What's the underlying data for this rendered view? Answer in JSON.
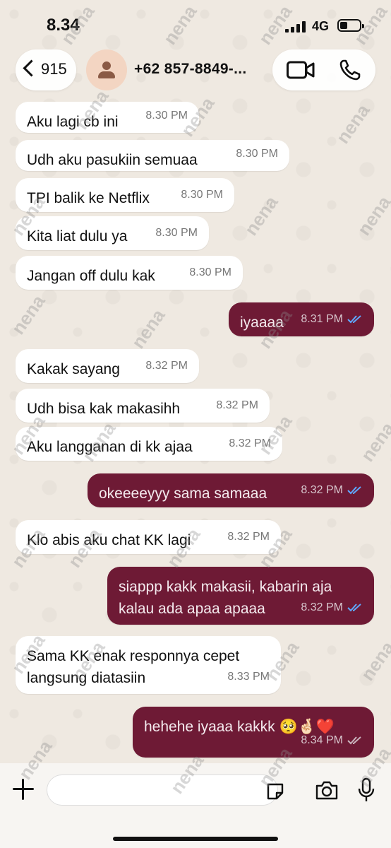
{
  "status_bar": {
    "time": "8.34",
    "network": "4G"
  },
  "header": {
    "back_count": "915",
    "contact_name": "+62 857-8849-...",
    "video_icon": "video-call-icon",
    "phone_icon": "phone-call-icon"
  },
  "messages": [
    {
      "dir": "in",
      "text": "Aku lagi cb ini",
      "time": "8.30 PM"
    },
    {
      "dir": "in",
      "text": "Udh aku pasukiin semuaa",
      "time": "8.30 PM"
    },
    {
      "dir": "in",
      "text": "TPI balik ke Netflix",
      "time": "8.30 PM"
    },
    {
      "dir": "in",
      "text": "Kita liat dulu ya",
      "time": "8.30 PM"
    },
    {
      "dir": "in",
      "text": "Jangan off dulu kak",
      "time": "8.30 PM"
    },
    {
      "dir": "out",
      "text": "iyaaaa",
      "time": "8.31 PM",
      "read": true
    },
    {
      "dir": "in",
      "text": "Kakak sayang",
      "time": "8.32 PM"
    },
    {
      "dir": "in",
      "text": "Udh bisa kak makasihh",
      "time": "8.32 PM"
    },
    {
      "dir": "in",
      "text": "Aku langganan di kk ajaa",
      "time": "8.32 PM"
    },
    {
      "dir": "out",
      "text": "okeeeeyyy sama samaaa",
      "time": "8.32 PM",
      "read": true
    },
    {
      "dir": "in",
      "text": "Klo abis aku chat KK lagi",
      "time": "8.32 PM"
    },
    {
      "dir": "out",
      "text": "siappp kakk makasii, kabarin aja\nkalau ada apaa apaaa",
      "time": "8.32 PM",
      "read": true
    },
    {
      "dir": "in",
      "text": "Sama KK enak responnya cepet\nlangsung diatasiin",
      "time": "8.33 PM"
    },
    {
      "dir": "out",
      "text": "hehehe iyaaa kakkk 🥺🤞🏻❤️",
      "time": "8.34 PM",
      "read": false
    }
  ],
  "watermark": "nena",
  "colors": {
    "outgoing_bubble": "#6e1a35",
    "incoming_bubble": "#ffffff",
    "read_ticks": "#5fa8ff",
    "background": "#efe9e1"
  }
}
